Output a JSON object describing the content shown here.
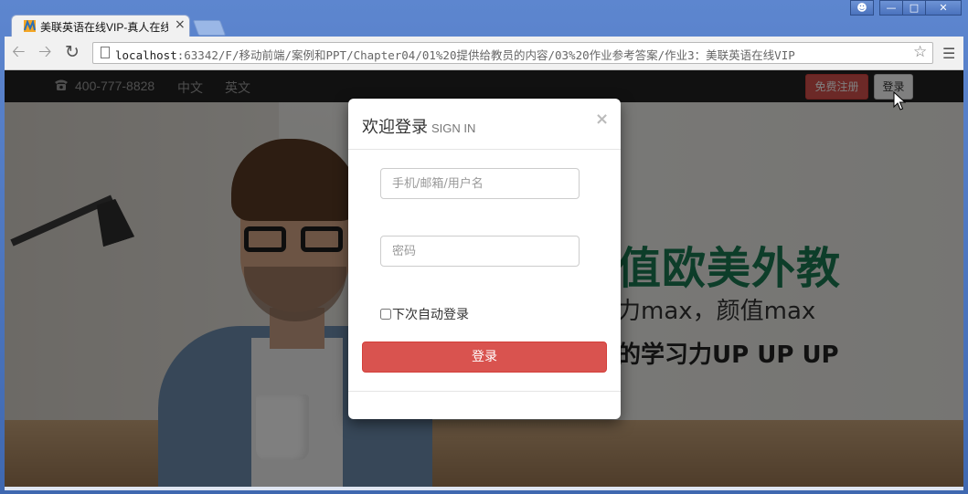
{
  "browser": {
    "tab_title": "美联英语在线VIP-真人在线",
    "tab_close": "×",
    "url_host": "localhost",
    "url_rest": ":63342/F/移动前端/案例和PPT/Chapter04/01%20提供给教员的内容/03%20作业参考答案/作业3：美联英语在线VIP",
    "back_icon": "back-arrow-icon",
    "forward_icon": "forward-arrow-icon",
    "reload_icon": "reload-icon",
    "star_icon": "bookmark-star-icon",
    "menu_icon": "hamburger-menu-icon",
    "window_controls": [
      "user-icon",
      "minimize-icon",
      "maximize-icon",
      "close-icon"
    ]
  },
  "navbar": {
    "phone": "400-777-8828",
    "lang_cn": "中文",
    "lang_en": "英文",
    "register_label": "免费注册",
    "login_label": "登录"
  },
  "hero": {
    "headline": "值欧美外教",
    "subline": "力max，颜值max",
    "tagline": "的学习力UP UP UP"
  },
  "modal": {
    "title": "欢迎登录",
    "subtitle": "SIGN IN",
    "close": "×",
    "username_placeholder": "手机/邮箱/用户名",
    "password_placeholder": "密码",
    "remember_label": "下次自动登录",
    "submit_label": "登录"
  },
  "colors": {
    "primary_danger": "#d9534f",
    "navbar_bg": "#222222",
    "hero_green": "#1a7a52"
  }
}
